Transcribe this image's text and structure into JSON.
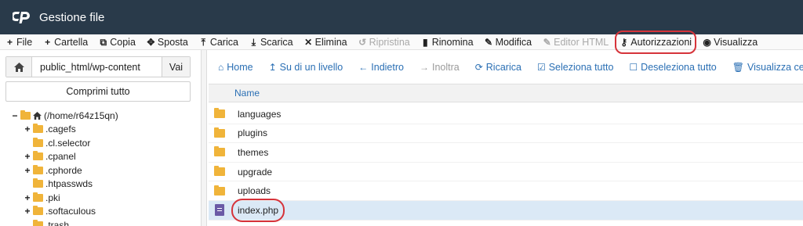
{
  "header": {
    "title": "Gestione file"
  },
  "toolbar": [
    {
      "label": "File",
      "icon": "plus-icon",
      "glyph": "+",
      "disabled": false,
      "highlight": false
    },
    {
      "label": "Cartella",
      "icon": "plus-icon",
      "glyph": "+",
      "disabled": false,
      "highlight": false
    },
    {
      "label": "Copia",
      "icon": "copy-icon",
      "glyph": "⧉",
      "disabled": false,
      "highlight": false
    },
    {
      "label": "Sposta",
      "icon": "move-icon",
      "glyph": "✥",
      "disabled": false,
      "highlight": false
    },
    {
      "label": "Carica",
      "icon": "upload-icon",
      "glyph": "⤒",
      "disabled": false,
      "highlight": false
    },
    {
      "label": "Scarica",
      "icon": "download-icon",
      "glyph": "⤓",
      "disabled": false,
      "highlight": false
    },
    {
      "label": "Elimina",
      "icon": "delete-icon",
      "glyph": "✕",
      "disabled": false,
      "highlight": false
    },
    {
      "label": "Ripristina",
      "icon": "restore-icon",
      "glyph": "↺",
      "disabled": true,
      "highlight": false
    },
    {
      "label": "Rinomina",
      "icon": "rename-icon",
      "glyph": "▮",
      "disabled": false,
      "highlight": false
    },
    {
      "label": "Modifica",
      "icon": "edit-icon",
      "glyph": "✎",
      "disabled": false,
      "highlight": false
    },
    {
      "label": "Editor HTML",
      "icon": "html-editor-icon",
      "glyph": "✎",
      "disabled": true,
      "highlight": false
    },
    {
      "label": "Autorizzazioni",
      "icon": "key-icon",
      "glyph": "⚷",
      "disabled": false,
      "highlight": true
    },
    {
      "label": "Visualizza",
      "icon": "eye-icon",
      "glyph": "◉",
      "disabled": false,
      "highlight": false
    }
  ],
  "sidebar": {
    "path_value": "public_html/wp-content",
    "go_label": "Vai",
    "collapse_label": "Comprimi tutto",
    "root_label": "(/home/r64z15qn)",
    "items": [
      {
        "label": ".cagefs",
        "expandable": true
      },
      {
        "label": ".cl.selector",
        "expandable": false
      },
      {
        "label": ".cpanel",
        "expandable": true
      },
      {
        "label": ".cphorde",
        "expandable": true
      },
      {
        "label": ".htpasswds",
        "expandable": false
      },
      {
        "label": ".pki",
        "expandable": true
      },
      {
        "label": ".softaculous",
        "expandable": true
      },
      {
        "label": ".trash",
        "expandable": false
      }
    ]
  },
  "nav": [
    {
      "label": "Home",
      "icon": "home-icon",
      "glyph": "⌂",
      "disabled": false
    },
    {
      "label": "Su di un livello",
      "icon": "level-up-icon",
      "glyph": "↥",
      "disabled": false
    },
    {
      "label": "Indietro",
      "icon": "back-icon",
      "glyph": "←",
      "disabled": false
    },
    {
      "label": "Inoltra",
      "icon": "forward-icon",
      "glyph": "→",
      "disabled": true
    },
    {
      "label": "Ricarica",
      "icon": "reload-icon",
      "glyph": "⟳",
      "disabled": false
    },
    {
      "label": "Seleziona tutto",
      "icon": "checkbox-checked-icon",
      "glyph": "☑",
      "disabled": false
    },
    {
      "label": "Deseleziona tutto",
      "icon": "checkbox-empty-icon",
      "glyph": "☐",
      "disabled": false
    },
    {
      "label": "Visualizza cestino",
      "icon": "trash-icon",
      "glyph": "🗑",
      "disabled": false
    }
  ],
  "table": {
    "header_name": "Name",
    "rows": [
      {
        "name": "languages",
        "type": "folder",
        "selected": false
      },
      {
        "name": "plugins",
        "type": "folder",
        "selected": false
      },
      {
        "name": "themes",
        "type": "folder",
        "selected": false
      },
      {
        "name": "upgrade",
        "type": "folder",
        "selected": false
      },
      {
        "name": "uploads",
        "type": "folder",
        "selected": false
      },
      {
        "name": "index.php",
        "type": "file",
        "selected": true
      }
    ]
  },
  "colors": {
    "header_bg": "#293a4a",
    "link_blue": "#2a6fb4",
    "highlight_red": "#d6333a",
    "folder_yellow": "#f0b43a",
    "selected_row": "#dbe9f6"
  }
}
